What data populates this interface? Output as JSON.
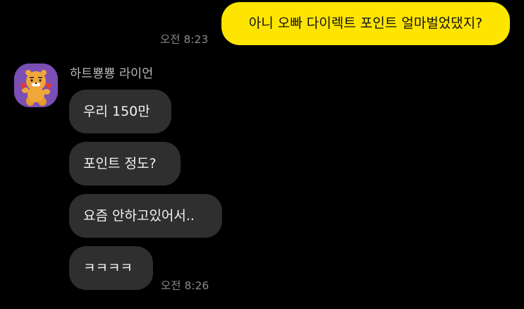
{
  "sent_message": {
    "text": "아니 오빠 다이렉트 포인트 얼마벌었댔지?",
    "time": "오전 8:23"
  },
  "received": {
    "sender_name": "하트뿅뿅 라이언",
    "avatar_icon": "ryan-character-icon",
    "time": "오전 8:26",
    "messages": [
      "우리 150만",
      "포인트 정도?",
      "요즘 안하고있어서..",
      "ㅋㅋㅋㅋ"
    ]
  },
  "colors": {
    "background": "#000000",
    "sent_bubble": "#FEE500",
    "received_bubble": "#2F2F2F",
    "avatar_bg": "#7B4FB5"
  }
}
